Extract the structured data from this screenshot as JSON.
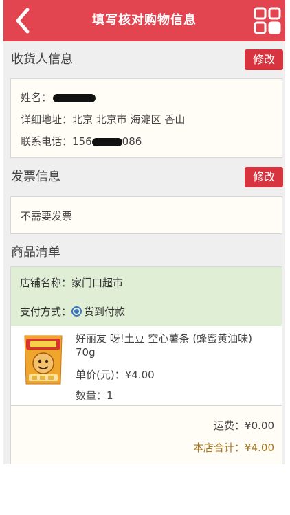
{
  "header": {
    "title": "填写核对购物信息",
    "back_icon": "chevron-left-icon",
    "menu_icon": "grid-icon",
    "background": "#e2454f"
  },
  "recipient": {
    "section_title": "收货人信息",
    "edit_label": "修改",
    "name_label": "姓名：",
    "address_label": "详细地址：",
    "address_value": "北京 北京市 海淀区 香山",
    "phone_label": "联系电话：",
    "phone_prefix": "156",
    "phone_suffix": "086"
  },
  "invoice": {
    "section_title": "发票信息",
    "edit_label": "修改",
    "value": "不需要发票"
  },
  "goods": {
    "section_title": "商品清单",
    "store_label": "店铺名称：",
    "store_name": "家门口超市",
    "payment_label": "支付方式：",
    "payment_method": "货到付款",
    "product_name": "好丽友 呀!土豆 空心薯条 (蜂蜜黄油味) 70g",
    "unit_price_label": "单价(元)：",
    "unit_price": "¥4.00",
    "quantity_label": "数量：",
    "quantity": "1",
    "shipping_label": "运费：",
    "shipping_value": "¥0.00",
    "store_total_label": "本店合计：",
    "store_total_value": "¥4.00"
  },
  "colors": {
    "accent_red": "#d8343f",
    "store_header_green": "#dfeed5",
    "total_brown": "#a9781f"
  }
}
